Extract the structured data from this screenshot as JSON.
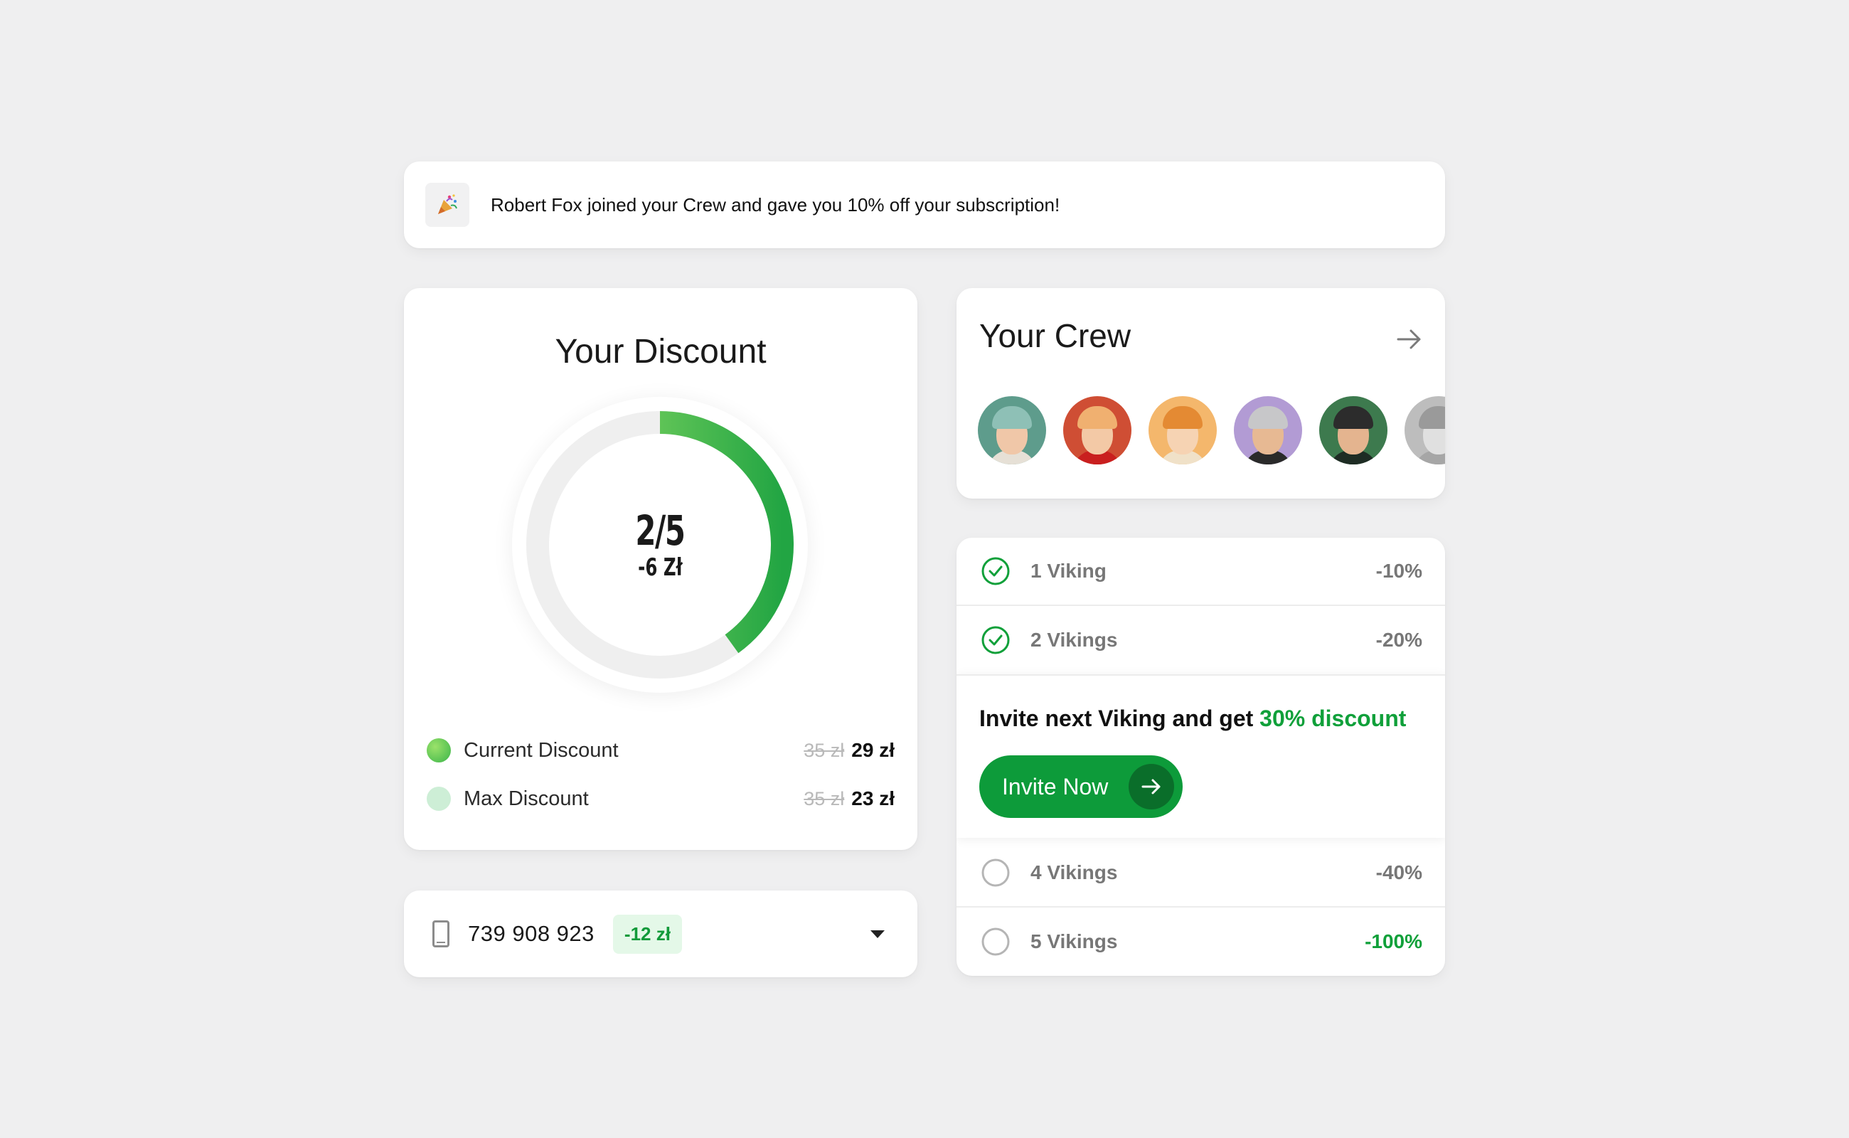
{
  "notification": {
    "icon": "party-popper-icon",
    "text": "Robert Fox joined your Crew and gave you 10% off your subscription!"
  },
  "discount": {
    "title": "Your Discount",
    "progress_fraction": 0.4,
    "fraction_label": "2/5",
    "amount_label": "-6 Zł",
    "accent_color": "#3bb54a",
    "legend": [
      {
        "label": "Current Discount",
        "old_price": "35 zł",
        "new_price": "29 zł",
        "color": "#5cc24e"
      },
      {
        "label": "Max Discount",
        "old_price": "35 zł",
        "new_price": "23 zł",
        "color": "#cdeed6"
      }
    ]
  },
  "phone": {
    "icon": "phone-icon",
    "number": "739 908 923",
    "badge": "-12 zł"
  },
  "crew": {
    "title": "Your Crew",
    "arrow_icon": "arrow-right-icon",
    "avatars": [
      {
        "name": "avatar-1",
        "bg": "#5e9c8c",
        "skin": "#f0c7a8",
        "helmet": "#8ec0b6",
        "shirt": "#e6e0d6"
      },
      {
        "name": "avatar-2",
        "bg": "#cf4e34",
        "skin": "#f3c9a6",
        "helmet": "#f0b070",
        "shirt": "#c91f1f"
      },
      {
        "name": "avatar-3",
        "bg": "#f4b76c",
        "skin": "#f6d3b3",
        "helmet": "#e48a33",
        "shirt": "#f0e1c8"
      },
      {
        "name": "avatar-4",
        "bg": "#b29bd4",
        "skin": "#e7b993",
        "helmet": "#c7c7c9",
        "shirt": "#2a2a2a"
      },
      {
        "name": "avatar-5",
        "bg": "#3d7a4e",
        "skin": "#e4b48f",
        "helmet": "#2c2c2c",
        "shirt": "#1e2c24"
      },
      {
        "name": "avatar-6",
        "bg": "#bdbdbd",
        "skin": "#e0e0e0",
        "helmet": "#9a9a9a",
        "shirt": "#a6a6a6"
      }
    ]
  },
  "vikings": {
    "rows": [
      {
        "label": "1 Viking",
        "pct": "-10%",
        "checked": true
      },
      {
        "label": "2 Vikings",
        "pct": "-20%",
        "checked": true
      },
      {
        "label": "4 Vikings",
        "pct": "-40%",
        "checked": false
      },
      {
        "label": "5 Vikings",
        "pct": "-100%",
        "checked": false,
        "highlight": true
      }
    ],
    "invite_text_prefix": "Invite next Viking and get ",
    "invite_text_highlight": "30% discount",
    "invite_button": "Invite Now"
  }
}
